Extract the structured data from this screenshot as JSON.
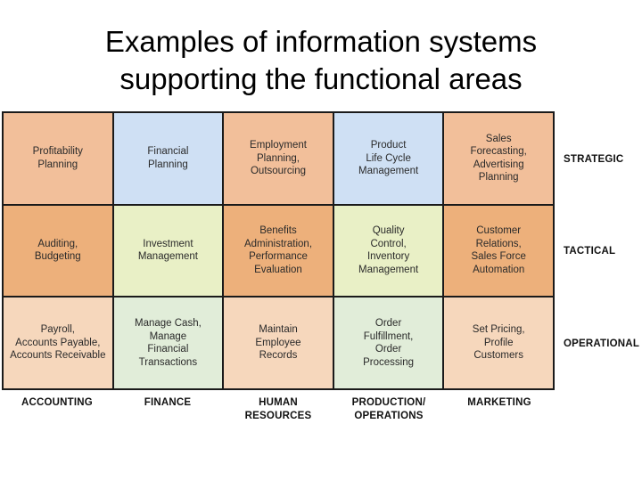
{
  "title": {
    "line1": "Examples of information systems",
    "line2": "supporting the functional areas"
  },
  "levels": [
    {
      "label": "STRATEGIC"
    },
    {
      "label": "TACTICAL"
    },
    {
      "label": "OPERATIONAL"
    }
  ],
  "functional_areas": [
    {
      "label": "ACCOUNTING"
    },
    {
      "label": "FINANCE"
    },
    {
      "label": "HUMAN\nRESOURCES"
    },
    {
      "label": "PRODUCTION/\nOPERATIONS"
    },
    {
      "label": "MARKETING"
    }
  ],
  "colors": {
    "strategic_orange": "#F2BF9A",
    "strategic_blue": "#CFE0F4",
    "tactical_orange": "#EDB07B",
    "tactical_green": "#E9F0C6",
    "operational_peach": "#F6D7BC",
    "operational_green": "#E1EDD9"
  },
  "cells": [
    [
      {
        "text": "Profitability\nPlanning",
        "color": "#F2BF9A"
      },
      {
        "text": "Financial\nPlanning",
        "color": "#CFE0F4"
      },
      {
        "text": "Employment\nPlanning,\nOutsourcing",
        "color": "#F2BF9A"
      },
      {
        "text": "Product\nLife Cycle\nManagement",
        "color": "#CFE0F4"
      },
      {
        "text": "Sales\nForecasting,\nAdvertising\nPlanning",
        "color": "#F2BF9A"
      }
    ],
    [
      {
        "text": "Auditing,\nBudgeting",
        "color": "#EDB07B"
      },
      {
        "text": "Investment\nManagement",
        "color": "#E9F0C6"
      },
      {
        "text": "Benefits\nAdministration,\nPerformance\nEvaluation",
        "color": "#EDB07B"
      },
      {
        "text": "Quality\nControl,\nInventory\nManagement",
        "color": "#E9F0C6"
      },
      {
        "text": "Customer\nRelations,\nSales Force\nAutomation",
        "color": "#EDB07B"
      }
    ],
    [
      {
        "text": "Payroll,\nAccounts Payable,\nAccounts Receivable",
        "color": "#F6D7BC"
      },
      {
        "text": "Manage Cash,\nManage\nFinancial\nTransactions",
        "color": "#E1EDD9"
      },
      {
        "text": "Maintain\nEmployee\nRecords",
        "color": "#F6D7BC"
      },
      {
        "text": "Order\nFulfillment,\nOrder\nProcessing",
        "color": "#E1EDD9"
      },
      {
        "text": "Set Pricing,\nProfile\nCustomers",
        "color": "#F6D7BC"
      }
    ]
  ]
}
